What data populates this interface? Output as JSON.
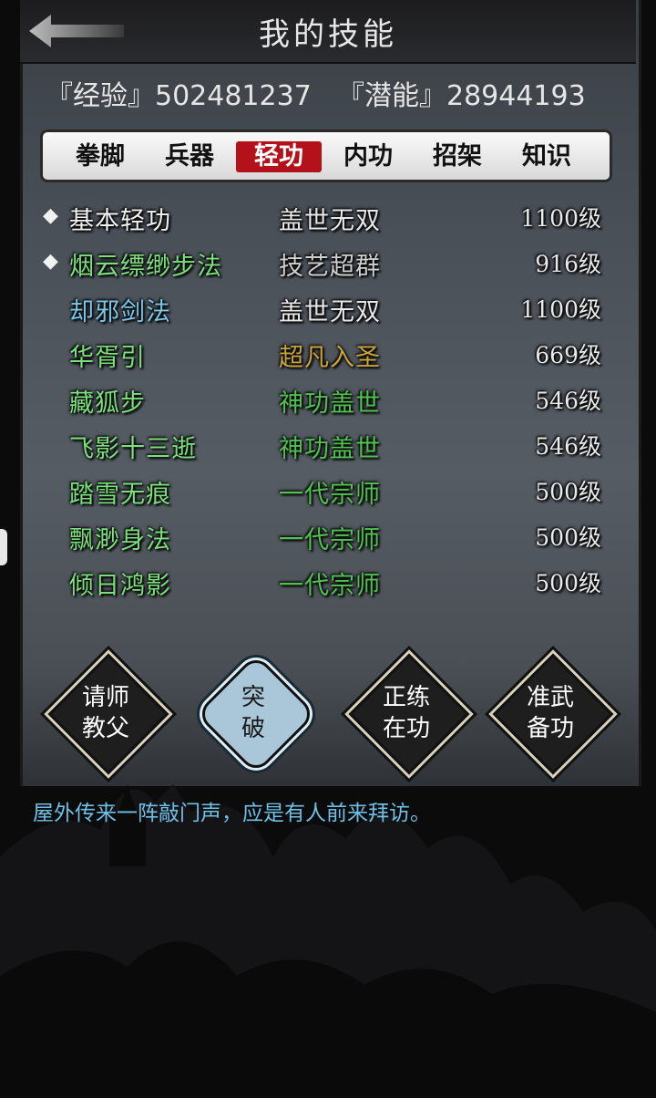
{
  "header": {
    "title": "我的技能"
  },
  "stats": {
    "exp_label": "『经验』502481237",
    "potential_label": "『潜能』28944193"
  },
  "tabs": [
    {
      "label": "拳脚",
      "active": false
    },
    {
      "label": "兵器",
      "active": false
    },
    {
      "label": "轻功",
      "active": true
    },
    {
      "label": "内功",
      "active": false
    },
    {
      "label": "招架",
      "active": false
    },
    {
      "label": "知识",
      "active": false
    }
  ],
  "skills": [
    {
      "marker": "◆",
      "name": "基本轻功",
      "rank": "盖世无双",
      "level": "1100级",
      "name_color": "#f2f2f2",
      "rank_color": "#e8e8e8"
    },
    {
      "marker": "◆",
      "name": "烟云缥缈步法",
      "rank": "技艺超群",
      "level": "916级",
      "name_color": "#7be07b",
      "rank_color": "#cfcfcf"
    },
    {
      "marker": "",
      "name": "却邪剑法",
      "rank": "盖世无双",
      "level": "1100级",
      "name_color": "#7cc7e8",
      "rank_color": "#e8e8e8"
    },
    {
      "marker": "",
      "name": "华胥引",
      "rank": "超凡入圣",
      "level": "669级",
      "name_color": "#7be07b",
      "rank_color": "#c9a43a"
    },
    {
      "marker": "",
      "name": "藏狐步",
      "rank": "神功盖世",
      "level": "546级",
      "name_color": "#7be07b",
      "rank_color": "#4fc24f"
    },
    {
      "marker": "",
      "name": "飞影十三逝",
      "rank": "神功盖世",
      "level": "546级",
      "name_color": "#7be07b",
      "rank_color": "#4fc24f"
    },
    {
      "marker": "",
      "name": "踏雪无痕",
      "rank": "一代宗师",
      "level": "500级",
      "name_color": "#7be07b",
      "rank_color": "#4fc24f"
    },
    {
      "marker": "",
      "name": "飘渺身法",
      "rank": "一代宗师",
      "level": "500级",
      "name_color": "#7be07b",
      "rank_color": "#4fc24f"
    },
    {
      "marker": "",
      "name": "倾日鸿影",
      "rank": "一代宗师",
      "level": "500级",
      "name_color": "#7be07b",
      "rank_color": "#4fc24f"
    }
  ],
  "buttons": [
    {
      "line1": "请师",
      "line2": "教父",
      "style": "dark"
    },
    {
      "line1": "突",
      "line2": "破",
      "style": "blue"
    },
    {
      "line1": "正练",
      "line2": "在功",
      "style": "dark"
    },
    {
      "line1": "准武",
      "line2": "备功",
      "style": "dark"
    }
  ],
  "message": "屋外传来一阵敲门声，应是有人前来拜访。",
  "colors": {
    "active_tab": "#b3121b",
    "message": "#6fc0e6"
  }
}
